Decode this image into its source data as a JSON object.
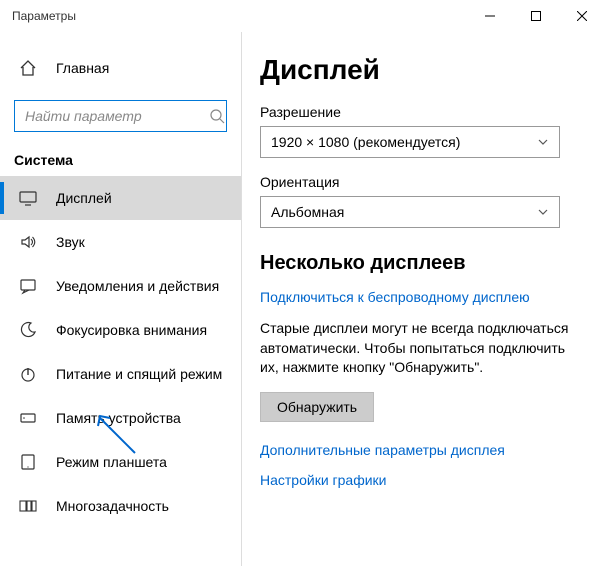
{
  "window": {
    "title": "Параметры"
  },
  "sidebar": {
    "home_label": "Главная",
    "search_placeholder": "Найти параметр",
    "section_label": "Система",
    "items": [
      {
        "label": "Дисплей"
      },
      {
        "label": "Звук"
      },
      {
        "label": "Уведомления и действия"
      },
      {
        "label": "Фокусировка внимания"
      },
      {
        "label": "Питание и спящий режим"
      },
      {
        "label": "Память устройства"
      },
      {
        "label": "Режим планшета"
      },
      {
        "label": "Многозадачность"
      }
    ]
  },
  "main": {
    "title": "Дисплей",
    "resolution_label": "Разрешение",
    "resolution_value": "1920 × 1080 (рекомендуется)",
    "orientation_label": "Ориентация",
    "orientation_value": "Альбомная",
    "multi_title": "Несколько дисплеев",
    "wireless_link": "Подключиться к беспроводному дисплею",
    "helper": "Старые дисплеи могут не всегда подключаться автоматически. Чтобы попытаться подключить их, нажмите кнопку \"Обнаружить\".",
    "detect_button": "Обнаружить",
    "advanced_link": "Дополнительные параметры дисплея",
    "graphics_link": "Настройки графики"
  }
}
